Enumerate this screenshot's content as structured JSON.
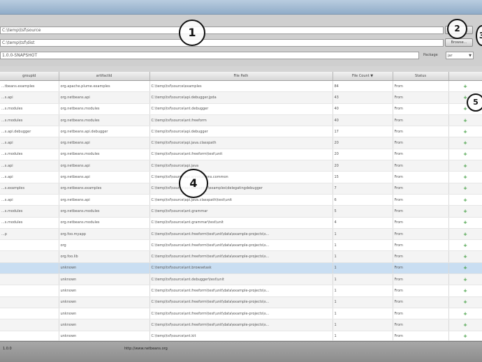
{
  "form": {
    "source_path": "C:\\temp\\tsf\\source",
    "dist_path": "C:\\temp\\tsf\\dist",
    "version": "1.0.0-SNAPSHOT",
    "browse_label": "Browse...",
    "package_label": "Package",
    "package_value": "jar"
  },
  "annotations": [
    "1",
    "2",
    "3",
    "4",
    "5"
  ],
  "table": {
    "headers": [
      "groupId",
      "artifactId",
      "File Path",
      "File Count",
      "Status",
      ""
    ],
    "sort_indicator": "▼",
    "rows": [
      [
        "...tbeans.examples",
        "org.apache.plume.examples",
        "C:\\temp\\tsf\\source\\examples",
        "84",
        "From",
        "+"
      ],
      [
        "...s.api",
        "org.netbeans.api",
        "C:\\temp\\tsf\\source\\api.debugger.jpda",
        "43",
        "From",
        "+"
      ],
      [
        "...s.modules",
        "org.netbeans.modules",
        "C:\\temp\\tsf\\source\\ant.debugger",
        "40",
        "From",
        "+"
      ],
      [
        "...s.modules",
        "org.netbeans.modules",
        "C:\\temp\\tsf\\source\\ant.freeform",
        "40",
        "From",
        "+"
      ],
      [
        "...s.api.debugger",
        "org.netbeans.api.debugger",
        "C:\\temp\\tsf\\source\\api.debugger",
        "17",
        "From",
        "+"
      ],
      [
        "...s.api",
        "org.netbeans.api",
        "C:\\temp\\tsf\\source\\api.java.classpath",
        "20",
        "From",
        "+"
      ],
      [
        "...s.modules",
        "org.netbeans.modules",
        "C:\\temp\\tsf\\source\\ant.freeform\\test\\unit",
        "20",
        "From",
        "+"
      ],
      [
        "...s.api",
        "org.netbeans.api",
        "C:\\temp\\tsf\\source\\api.java",
        "20",
        "From",
        "+"
      ],
      [
        "...s.api",
        "org.netbeans.api",
        "C:\\temp\\tsf\\source\\api.annotations.common",
        "15",
        "From",
        "+"
      ],
      [
        "...s.examples",
        "org.netbeans.examples",
        "C:\\temp\\tsf\\source\\api.debugger\\examples\\delegatingdebugger",
        "7",
        "From",
        "+"
      ],
      [
        "...s.api",
        "org.netbeans.api",
        "C:\\temp\\tsf\\source\\api.java.classpath\\test\\unit",
        "6",
        "From",
        "+"
      ],
      [
        "...s.modules",
        "org.netbeans.modules",
        "C:\\temp\\tsf\\source\\ant.grammar",
        "5",
        "From",
        "+"
      ],
      [
        "...s.modules",
        "org.netbeans.modules",
        "C:\\temp\\tsf\\source\\ant.grammar\\test\\unit",
        "4",
        "From",
        "+"
      ],
      [
        "...p",
        "org.foo.myapp",
        "C:\\temp\\tsf\\source\\ant.freeform\\test\\unit\\data\\example-projects\\s...",
        "1",
        "From",
        "+"
      ],
      [
        "",
        "org",
        "C:\\temp\\tsf\\source\\ant.freeform\\test\\unit\\data\\example-projects\\s...",
        "1",
        "From",
        "+"
      ],
      [
        "",
        "org.foo.lib",
        "C:\\temp\\tsf\\source\\ant.freeform\\test\\unit\\data\\example-projects\\s...",
        "1",
        "From",
        "+"
      ],
      [
        "",
        "unknown",
        "C:\\temp\\tsf\\source\\ant.browsetask",
        "1",
        "From",
        "+"
      ],
      [
        "",
        "unknown",
        "C:\\temp\\tsf\\source\\ant.debugger\\test\\unit",
        "1",
        "From",
        "+"
      ],
      [
        "",
        "unknown",
        "C:\\temp\\tsf\\source\\ant.freeform\\test\\unit\\data\\example-projects\\s...",
        "1",
        "From",
        "+"
      ],
      [
        "",
        "unknown",
        "C:\\temp\\tsf\\source\\ant.freeform\\test\\unit\\data\\example-projects\\s...",
        "1",
        "From",
        "+"
      ],
      [
        "",
        "unknown",
        "C:\\temp\\tsf\\source\\ant.freeform\\test\\unit\\data\\example-projects\\s...",
        "1",
        "From",
        "+"
      ],
      [
        "",
        "unknown",
        "C:\\temp\\tsf\\source\\ant.freeform\\test\\unit\\data\\example-projects\\s...",
        "1",
        "From",
        "+"
      ],
      [
        "",
        "unknown",
        "C:\\temp\\tsf\\source\\ant.kit",
        "1",
        "From",
        "+"
      ]
    ],
    "selected_row": 16
  },
  "status": {
    "version": "1.0.0",
    "url": "http://www.netbeans.org"
  },
  "colors": {
    "title_bar": "#9db5cf",
    "selection": "#c9def2",
    "add_icon": "#3a9a3a"
  }
}
